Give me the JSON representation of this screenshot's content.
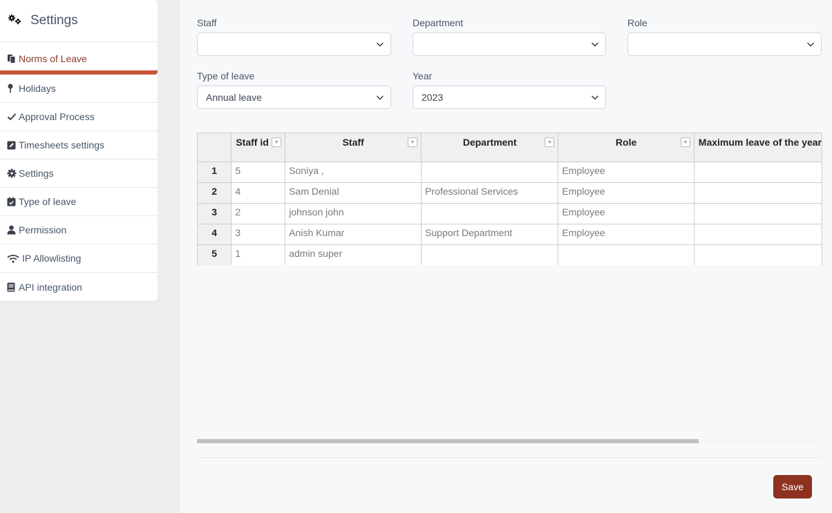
{
  "sidebar": {
    "title": "Settings",
    "items": [
      {
        "label": "Norms of Leave",
        "icon": "copy-icon",
        "active": true
      },
      {
        "label": "Holidays",
        "icon": "map-pin-icon"
      },
      {
        "label": "Approval Process",
        "icon": "check-icon"
      },
      {
        "label": "Timesheets settings",
        "icon": "edit-square-icon"
      },
      {
        "label": "Settings",
        "icon": "gear-icon"
      },
      {
        "label": "Type of leave",
        "icon": "calendar-check-icon"
      },
      {
        "label": "Permission",
        "icon": "user-icon"
      },
      {
        "label": "IP Allowlisting",
        "icon": "wifi-icon"
      },
      {
        "label": "API integration",
        "icon": "book-icon"
      }
    ]
  },
  "filters": {
    "staff": {
      "label": "Staff",
      "value": ""
    },
    "department": {
      "label": "Department",
      "value": ""
    },
    "role": {
      "label": "Role",
      "value": ""
    },
    "type_of_leave": {
      "label": "Type of leave",
      "value": "Annual leave"
    },
    "year": {
      "label": "Year",
      "value": "2023"
    }
  },
  "table": {
    "columns": [
      "Staff id",
      "Staff",
      "Department",
      "Role",
      "Maximum leave of the year"
    ],
    "rows": [
      {
        "num": "1",
        "staff_id": "5",
        "staff": "Soniya ,",
        "department": "",
        "role": "Employee",
        "max_leave": ""
      },
      {
        "num": "2",
        "staff_id": "4",
        "staff": "Sam Denial",
        "department": "Professional Services",
        "role": "Employee",
        "max_leave": ""
      },
      {
        "num": "3",
        "staff_id": "2",
        "staff": "johnson john",
        "department": "",
        "role": "Employee",
        "max_leave": ""
      },
      {
        "num": "4",
        "staff_id": "3",
        "staff": "Anish Kumar",
        "department": "Support Department",
        "role": "Employee",
        "max_leave": ""
      },
      {
        "num": "5",
        "staff_id": "1",
        "staff": "admin super",
        "department": "",
        "role": "",
        "max_leave": ""
      }
    ]
  },
  "footer": {
    "save_label": "Save"
  },
  "colors": {
    "accent": "#c8553a",
    "save_button": "#8f311f",
    "active_text": "#8c3a2b"
  }
}
